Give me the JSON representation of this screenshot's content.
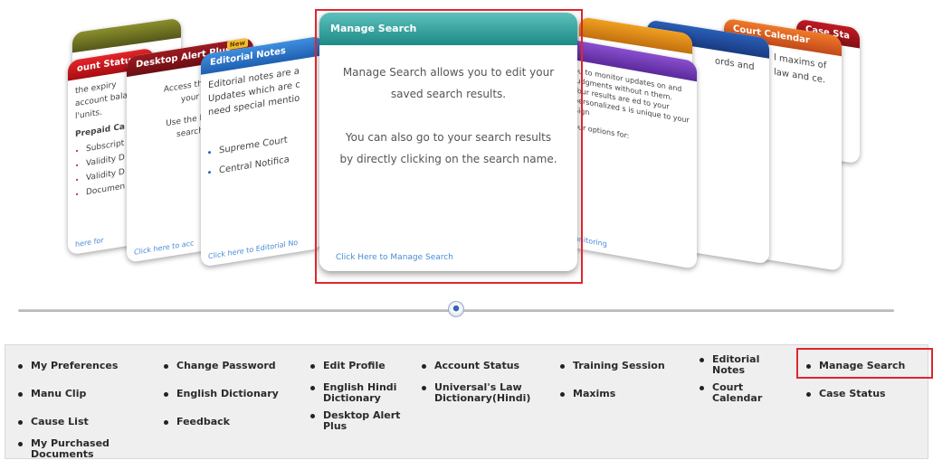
{
  "carousel": {
    "cards": {
      "account_status": {
        "title": "ount Status",
        "lines": [
          "the expiry",
          "account bala",
          "l'units."
        ],
        "section": "Prepaid Ca",
        "items": [
          "Subscript",
          "Validity D",
          "Validity D",
          "Documen"
        ],
        "link": "here for"
      },
      "desktop_alert": {
        "title": "Desktop Alert Plus",
        "badge": "New",
        "lines": [
          "Access the D",
          "your",
          "Use the Key",
          "search"
        ],
        "link": "Click here to acc"
      },
      "editorial": {
        "title": "Editorial Notes",
        "text": "Editorial notes are a Updates which are c need special mentio",
        "items": [
          "Supreme Court",
          "Central Notifica"
        ],
        "link": "Click here to Editorial No"
      },
      "manage_search": {
        "title": "Manage Search",
        "paragraph1": "Manage Search allows you to edit your saved search results.",
        "paragraph2": "You can also go to your search results by directly clicking on the search name.",
        "link": "Click Here to Manage Search"
      },
      "training": {
        "text": "ou to monitor updates on and Judgments without n them. Your results are ed to your personalized s is unique to your Sign",
        "extra": "our options for:",
        "link": "Monitoring"
      },
      "blue_card": {
        "text": "ords and"
      },
      "court_card": {
        "title": "Court Calendar",
        "text": "l maxims of law and ce."
      },
      "case_card": {
        "title": "Case Sta"
      }
    }
  },
  "menu": {
    "row1": [
      "My Preferences",
      "Change Password",
      "Edit Profile",
      "Account Status",
      "Training Session",
      "Editorial Notes",
      "Manage Search"
    ],
    "row2": [
      "Manu Clip",
      "English Dictionary",
      "English Hindi Dictionary",
      "Universal's Law Dictionary(Hindi)",
      "Maxims",
      "Court Calendar",
      "Case Status"
    ],
    "row3": [
      "Cause List",
      "Feedback",
      "Desktop Alert Plus"
    ],
    "row4": [
      "My Purchased Documents"
    ]
  },
  "colors": {
    "highlight": "#e0262e",
    "front_header": "#1e8a86",
    "menu_bg": "#efefef"
  }
}
